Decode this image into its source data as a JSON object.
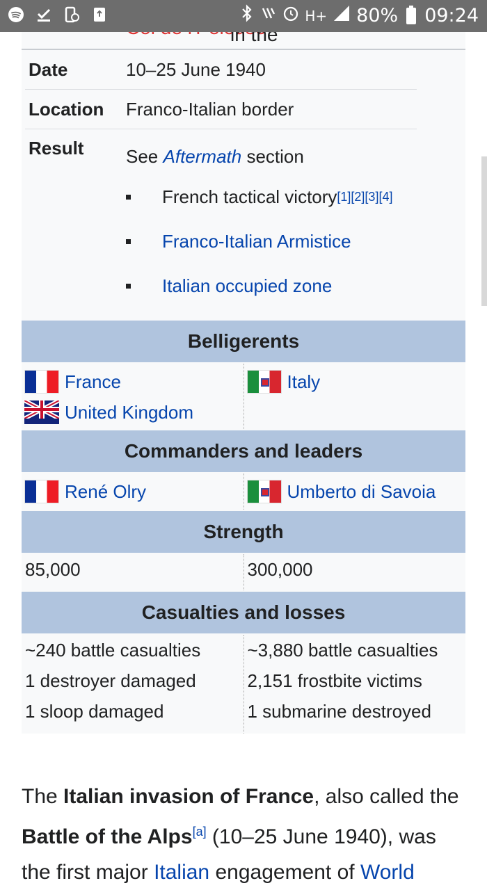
{
  "status_bar": {
    "battery": "80%",
    "time": "09:24",
    "network": "H+"
  },
  "infobox": {
    "top_partial_text": "action in the ",
    "top_partial_link": "Col de l'Pelouse",
    "date_label": "Date",
    "date_value": "10–25 June 1940",
    "location_label": "Location",
    "location_value": "Franco-Italian border",
    "result_label": "Result",
    "result_see_prefix": "See ",
    "result_see_link": "Aftermath",
    "result_see_suffix": " section",
    "result_items": [
      {
        "text": "French tactical victory",
        "refs": "[1][2][3][4]",
        "is_link": false
      },
      {
        "text": "Franco-Italian Armistice",
        "refs": "",
        "is_link": true
      },
      {
        "text": "Italian occupied zone",
        "refs": "",
        "is_link": true
      }
    ],
    "belligerents_header": "Belligerents",
    "belligerents_left": [
      "France",
      "United Kingdom"
    ],
    "belligerents_right": [
      "Italy"
    ],
    "commanders_header": "Commanders and leaders",
    "commander_left": "René Olry",
    "commander_right": "Umberto di Savoia",
    "strength_header": "Strength",
    "strength_left": "85,000",
    "strength_right": "300,000",
    "casualties_header": "Casualties and losses",
    "casualties_left": [
      "~240 battle casualties",
      "1 destroyer damaged",
      "1 sloop damaged"
    ],
    "casualties_right": [
      "~3,880 battle casualties",
      "2,151 frostbite victims",
      "1 submarine destroyed"
    ]
  },
  "article": {
    "p1_a": "The ",
    "p1_bold1": "Italian invasion of France",
    "p1_b": ", also called the ",
    "p1_bold2": "Battle of the Alps",
    "p1_note": "[a]",
    "p1_c": " (10–25 June 1940), was",
    "p1_d": "the first major ",
    "p1_link1": "Italian",
    "p1_e": " engagement of ",
    "p1_link2": "World"
  }
}
